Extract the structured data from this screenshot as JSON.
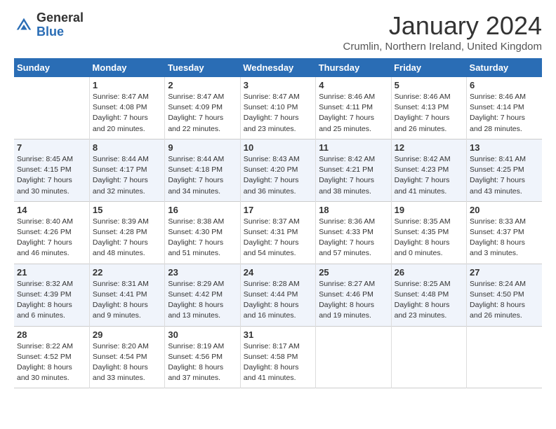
{
  "logo": {
    "general": "General",
    "blue": "Blue"
  },
  "title": "January 2024",
  "subtitle": "Crumlin, Northern Ireland, United Kingdom",
  "days_header": [
    "Sunday",
    "Monday",
    "Tuesday",
    "Wednesday",
    "Thursday",
    "Friday",
    "Saturday"
  ],
  "weeks": [
    {
      "alt": false,
      "days": [
        {
          "num": "",
          "info": ""
        },
        {
          "num": "1",
          "info": "Sunrise: 8:47 AM\nSunset: 4:08 PM\nDaylight: 7 hours\nand 20 minutes."
        },
        {
          "num": "2",
          "info": "Sunrise: 8:47 AM\nSunset: 4:09 PM\nDaylight: 7 hours\nand 22 minutes."
        },
        {
          "num": "3",
          "info": "Sunrise: 8:47 AM\nSunset: 4:10 PM\nDaylight: 7 hours\nand 23 minutes."
        },
        {
          "num": "4",
          "info": "Sunrise: 8:46 AM\nSunset: 4:11 PM\nDaylight: 7 hours\nand 25 minutes."
        },
        {
          "num": "5",
          "info": "Sunrise: 8:46 AM\nSunset: 4:13 PM\nDaylight: 7 hours\nand 26 minutes."
        },
        {
          "num": "6",
          "info": "Sunrise: 8:46 AM\nSunset: 4:14 PM\nDaylight: 7 hours\nand 28 minutes."
        }
      ]
    },
    {
      "alt": true,
      "days": [
        {
          "num": "7",
          "info": "Sunrise: 8:45 AM\nSunset: 4:15 PM\nDaylight: 7 hours\nand 30 minutes."
        },
        {
          "num": "8",
          "info": "Sunrise: 8:44 AM\nSunset: 4:17 PM\nDaylight: 7 hours\nand 32 minutes."
        },
        {
          "num": "9",
          "info": "Sunrise: 8:44 AM\nSunset: 4:18 PM\nDaylight: 7 hours\nand 34 minutes."
        },
        {
          "num": "10",
          "info": "Sunrise: 8:43 AM\nSunset: 4:20 PM\nDaylight: 7 hours\nand 36 minutes."
        },
        {
          "num": "11",
          "info": "Sunrise: 8:42 AM\nSunset: 4:21 PM\nDaylight: 7 hours\nand 38 minutes."
        },
        {
          "num": "12",
          "info": "Sunrise: 8:42 AM\nSunset: 4:23 PM\nDaylight: 7 hours\nand 41 minutes."
        },
        {
          "num": "13",
          "info": "Sunrise: 8:41 AM\nSunset: 4:25 PM\nDaylight: 7 hours\nand 43 minutes."
        }
      ]
    },
    {
      "alt": false,
      "days": [
        {
          "num": "14",
          "info": "Sunrise: 8:40 AM\nSunset: 4:26 PM\nDaylight: 7 hours\nand 46 minutes."
        },
        {
          "num": "15",
          "info": "Sunrise: 8:39 AM\nSunset: 4:28 PM\nDaylight: 7 hours\nand 48 minutes."
        },
        {
          "num": "16",
          "info": "Sunrise: 8:38 AM\nSunset: 4:30 PM\nDaylight: 7 hours\nand 51 minutes."
        },
        {
          "num": "17",
          "info": "Sunrise: 8:37 AM\nSunset: 4:31 PM\nDaylight: 7 hours\nand 54 minutes."
        },
        {
          "num": "18",
          "info": "Sunrise: 8:36 AM\nSunset: 4:33 PM\nDaylight: 7 hours\nand 57 minutes."
        },
        {
          "num": "19",
          "info": "Sunrise: 8:35 AM\nSunset: 4:35 PM\nDaylight: 8 hours\nand 0 minutes."
        },
        {
          "num": "20",
          "info": "Sunrise: 8:33 AM\nSunset: 4:37 PM\nDaylight: 8 hours\nand 3 minutes."
        }
      ]
    },
    {
      "alt": true,
      "days": [
        {
          "num": "21",
          "info": "Sunrise: 8:32 AM\nSunset: 4:39 PM\nDaylight: 8 hours\nand 6 minutes."
        },
        {
          "num": "22",
          "info": "Sunrise: 8:31 AM\nSunset: 4:41 PM\nDaylight: 8 hours\nand 9 minutes."
        },
        {
          "num": "23",
          "info": "Sunrise: 8:29 AM\nSunset: 4:42 PM\nDaylight: 8 hours\nand 13 minutes."
        },
        {
          "num": "24",
          "info": "Sunrise: 8:28 AM\nSunset: 4:44 PM\nDaylight: 8 hours\nand 16 minutes."
        },
        {
          "num": "25",
          "info": "Sunrise: 8:27 AM\nSunset: 4:46 PM\nDaylight: 8 hours\nand 19 minutes."
        },
        {
          "num": "26",
          "info": "Sunrise: 8:25 AM\nSunset: 4:48 PM\nDaylight: 8 hours\nand 23 minutes."
        },
        {
          "num": "27",
          "info": "Sunrise: 8:24 AM\nSunset: 4:50 PM\nDaylight: 8 hours\nand 26 minutes."
        }
      ]
    },
    {
      "alt": false,
      "days": [
        {
          "num": "28",
          "info": "Sunrise: 8:22 AM\nSunset: 4:52 PM\nDaylight: 8 hours\nand 30 minutes."
        },
        {
          "num": "29",
          "info": "Sunrise: 8:20 AM\nSunset: 4:54 PM\nDaylight: 8 hours\nand 33 minutes."
        },
        {
          "num": "30",
          "info": "Sunrise: 8:19 AM\nSunset: 4:56 PM\nDaylight: 8 hours\nand 37 minutes."
        },
        {
          "num": "31",
          "info": "Sunrise: 8:17 AM\nSunset: 4:58 PM\nDaylight: 8 hours\nand 41 minutes."
        },
        {
          "num": "",
          "info": ""
        },
        {
          "num": "",
          "info": ""
        },
        {
          "num": "",
          "info": ""
        }
      ]
    }
  ]
}
